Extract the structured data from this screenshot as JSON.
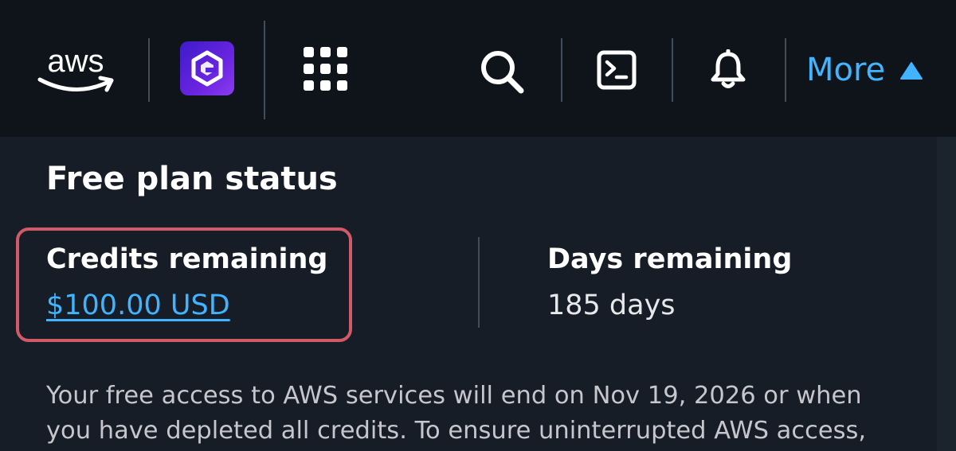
{
  "header": {
    "logo_text": "aws",
    "more_label": "More",
    "icons": [
      "aws-logo",
      "app-icon",
      "services-grid-icon",
      "search-icon",
      "cloudshell-icon",
      "bell-icon",
      "caret-up-icon"
    ]
  },
  "free_plan": {
    "title": "Free plan status",
    "credits_label": "Credits remaining",
    "credits_value": "$100.00 USD",
    "days_label": "Days remaining",
    "days_value": "185 days",
    "notice": "Your free access to AWS services will end on Nov 19, 2026 or when you have depleted all credits. To ensure uninterrupted AWS access,"
  },
  "colors": {
    "header_bg": "#0f141a",
    "content_bg": "#161d26",
    "link": "#42b4ff",
    "highlight_border": "#d05a67"
  }
}
